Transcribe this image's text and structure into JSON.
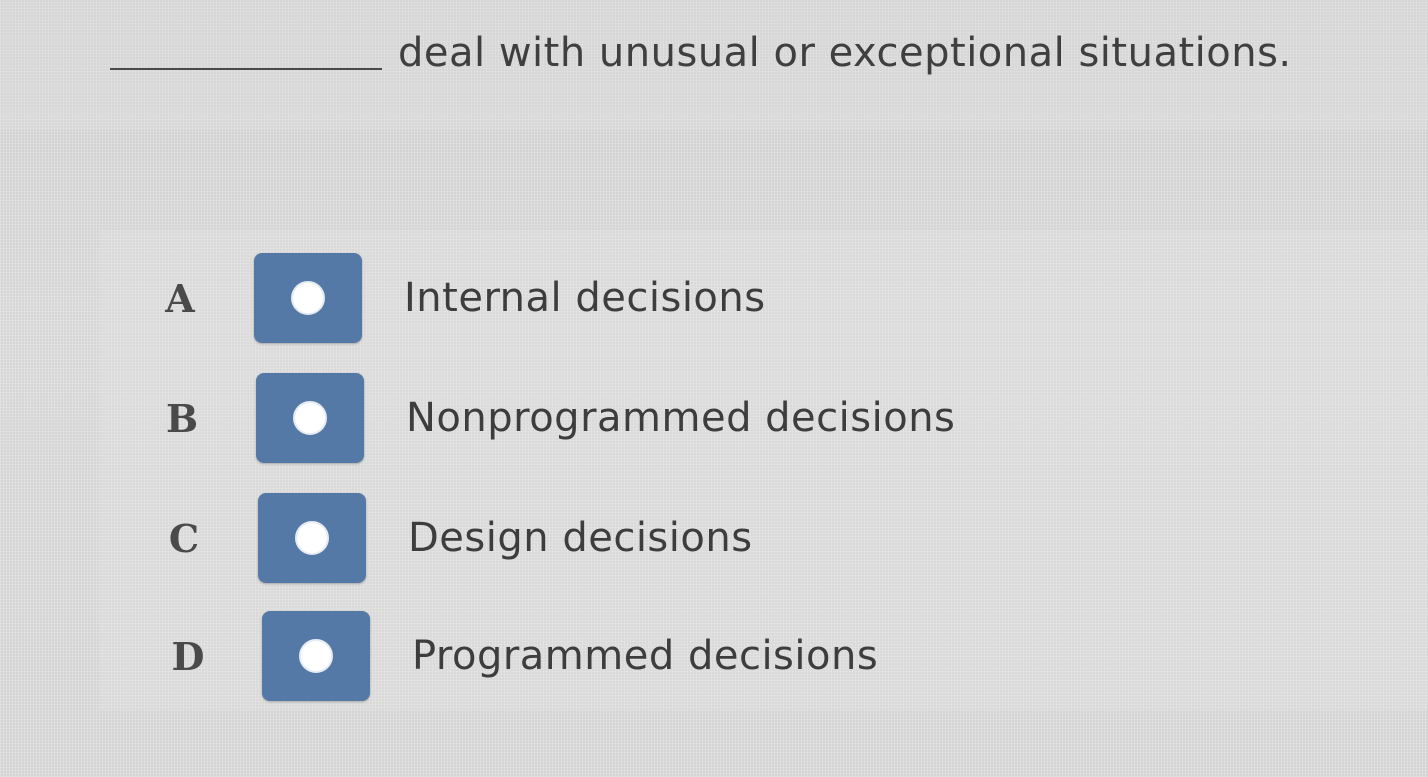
{
  "question": {
    "prompt_text": "deal with unusual or exceptional situations."
  },
  "options": [
    {
      "letter": "A",
      "text": "Internal decisions"
    },
    {
      "letter": "B",
      "text": "Nonprogrammed decisions"
    },
    {
      "letter": "C",
      "text": "Design decisions"
    },
    {
      "letter": "D",
      "text": "Programmed decisions"
    }
  ],
  "colors": {
    "radio_box": "#5579a6",
    "radio_dot": "#ffffff",
    "text": "#3d3d3d"
  },
  "icons": {
    "radio": "radio-button-icon"
  }
}
